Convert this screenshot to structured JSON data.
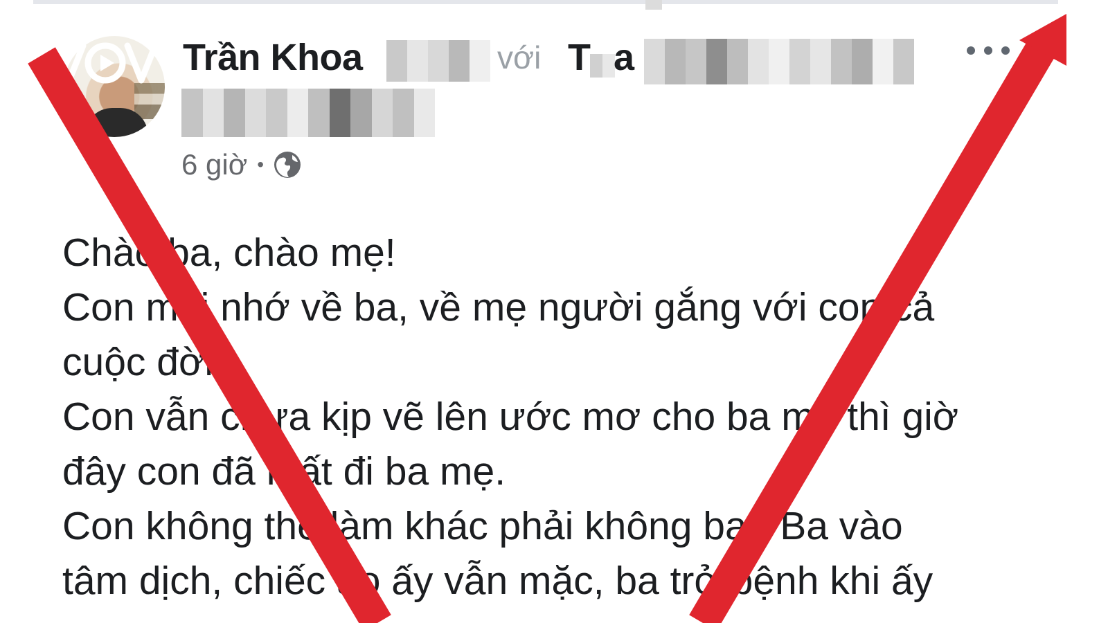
{
  "post": {
    "author_name": "Trần Khoa",
    "with_word": "với",
    "tagged_prefix": "T",
    "tagged_suffix": "a",
    "timestamp": "6 giờ",
    "separator": "•",
    "privacy_icon": "globe-icon",
    "more_icon": "more-options-icon",
    "body_lines": [
      "Chào ba, chào mẹ!",
      "Con mãi nhớ về ba, về mẹ người gắng với con cả",
      "cuộc đời",
      "Con vẫn chưa kịp vẽ lên ước mơ cho ba mẹ thì giờ",
      "đây con đã mất đi ba mẹ.",
      "Con không thể làm khác phải không ba? Ba vào",
      "tâm dịch, chiếc áo ấy vẫn mặc, ba trở bệnh khi ấy"
    ]
  },
  "watermark": {
    "logo": "vov-logo"
  },
  "colors": {
    "overlay_red": "#e0262e",
    "text": "#1c1e21",
    "meta": "#65676b"
  }
}
